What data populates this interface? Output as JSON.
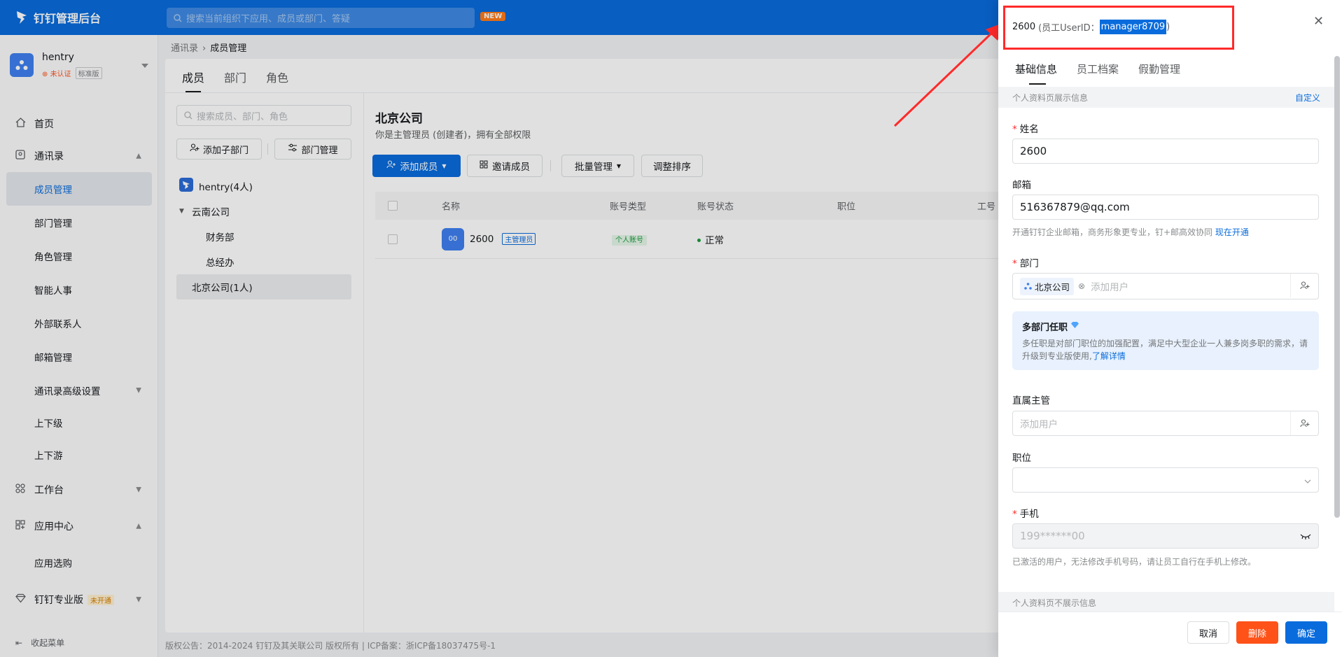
{
  "app": {
    "title": "钉钉管理后台",
    "search_placeholder": "搜索当前组织下应用、成员或部门、答疑",
    "new_badge": "NEW"
  },
  "org": {
    "name": "hentry",
    "unverified": "未认证",
    "edition": "标准版"
  },
  "sidebar": {
    "items": [
      {
        "label": "首页",
        "icon": "home-icon"
      },
      {
        "label": "通讯录",
        "icon": "contacts-icon"
      },
      {
        "label": "成员管理"
      },
      {
        "label": "部门管理"
      },
      {
        "label": "角色管理"
      },
      {
        "label": "智能人事"
      },
      {
        "label": "外部联系人"
      },
      {
        "label": "邮箱管理"
      },
      {
        "label": "通讯录高级设置"
      },
      {
        "label": "上下级"
      },
      {
        "label": "上下游"
      },
      {
        "label": "工作台",
        "icon": "workbench-icon"
      },
      {
        "label": "应用中心",
        "icon": "app-center-icon"
      },
      {
        "label": "应用选购"
      },
      {
        "label": "钉钉专业版",
        "icon": "diamond-icon",
        "tag": "未开通"
      }
    ],
    "collapse_label": "收起菜单"
  },
  "breadcrumb": {
    "parent": "通讯录",
    "current": "成员管理"
  },
  "main": {
    "tabs": [
      "成员",
      "部门",
      "角色"
    ],
    "dept_search_placeholder": "搜索成员、部门、角色",
    "add_sub_dept": "添加子部门",
    "dept_manage": "部门管理",
    "tree": {
      "root": "hentry(4人)",
      "yunnan": "云南公司",
      "finance": "财务部",
      "gm": "总经办",
      "beijing": "北京公司(1人)"
    },
    "title": "北京公司",
    "desc": "你是主管理员 (创建者)，拥有全部权限",
    "buttons": {
      "add_member": "添加成员",
      "invite": "邀请成员",
      "batch": "批量管理",
      "sort": "调整排序"
    },
    "table": {
      "headers": [
        "名称",
        "账号类型",
        "账号状态",
        "职位",
        "工号"
      ],
      "rows": [
        {
          "avatar": "00",
          "name": "2600",
          "role_tag": "主管理员",
          "account_type": "个人账号",
          "status": "正常"
        }
      ]
    },
    "footer": "版权公告：2014-2024 钉钉及其关联公司 版权所有 | ICP备案：浙ICP备18037475号-1"
  },
  "drawer": {
    "name": "2600",
    "uid_label": "(员工UserID：",
    "uid": "manager8709",
    "uid_close": ")",
    "tabs": [
      "基础信息",
      "员工档案",
      "假勤管理"
    ],
    "section_shown": "个人资料页展示信息",
    "customize": "自定义",
    "name_label": "姓名",
    "name_value": "2600",
    "email_label": "邮箱",
    "email_value": "516367879@qq.com",
    "email_help": "开通钉钉企业邮箱，商务形象更专业，钉+邮高效协同",
    "email_help_link": "现在开通",
    "dept_label": "部门",
    "dept_chip": "北京公司",
    "add_user_placeholder": "添加用户",
    "multi_title": "多部门任职",
    "multi_text": "多任职是对部门职位的加强配置，满足中大型企业一人兼多岗多职的需求，请升级到专业版使用,",
    "multi_link": "了解详情",
    "manager_label": "直属主管",
    "position_label": "职位",
    "phone_label": "手机",
    "phone_value": "199******00",
    "phone_help": "已激活的用户，无法修改手机号码，请让员工自行在手机上修改。",
    "section_hidden": "个人资料页不展示信息",
    "cancel": "取消",
    "delete": "删除",
    "confirm": "确定"
  },
  "colors": {
    "brand": "#0a6cdc",
    "danger": "#ff5219",
    "annotation": "#ff2a2a"
  }
}
